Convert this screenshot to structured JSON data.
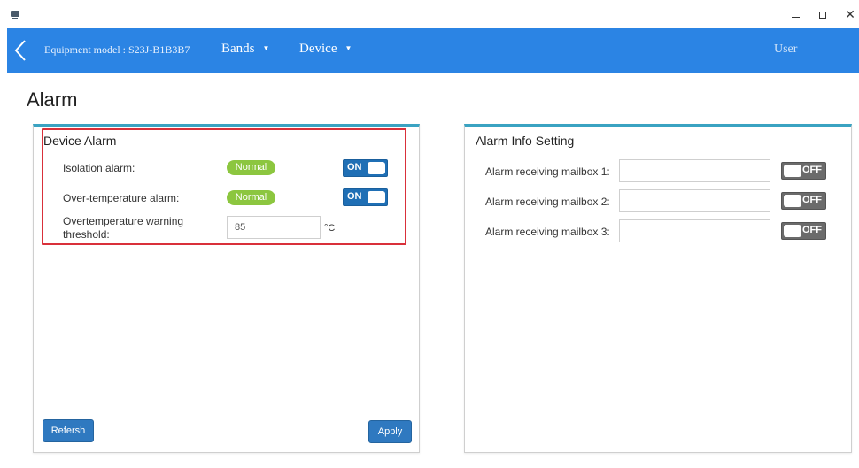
{
  "navbar": {
    "equipment_model": "Equipment model : S23J-B1B3B7",
    "bands_label": "Bands",
    "device_label": "Device",
    "user_label": "User",
    "accent_color": "#2b84e4"
  },
  "page": {
    "title": "Alarm"
  },
  "device_alarm": {
    "heading": "Device Alarm",
    "isolation": {
      "label": "Isolation alarm:",
      "status": "Normal",
      "toggle": "ON"
    },
    "over_temperature": {
      "label": "Over-temperature alarm:",
      "status": "Normal",
      "toggle": "ON"
    },
    "threshold": {
      "label": "Overtemperature warning threshold:",
      "value": "85",
      "unit": "°C"
    },
    "refresh_label": "Refersh",
    "apply_label": "Apply"
  },
  "alarm_info": {
    "heading": "Alarm Info Setting",
    "mailboxes": [
      {
        "label": "Alarm receiving mailbox 1:",
        "value": "",
        "toggle": "OFF"
      },
      {
        "label": "Alarm receiving mailbox 2:",
        "value": "",
        "toggle": "OFF"
      },
      {
        "label": "Alarm receiving mailbox 3:",
        "value": "",
        "toggle": "OFF"
      }
    ]
  },
  "colors": {
    "status_normal": "#8cc63f",
    "toggle_on": "#1f6fb5",
    "toggle_off": "#6b6b6b",
    "panel_top_border": "#3aa3c2",
    "highlight_box": "#d9303a"
  }
}
